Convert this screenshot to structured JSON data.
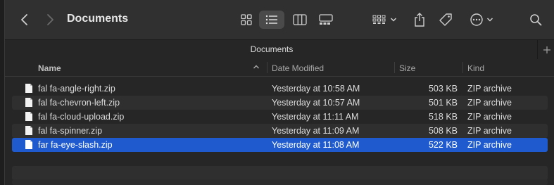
{
  "window": {
    "title": "Documents",
    "tab_label": "Documents"
  },
  "toolbar": {
    "back_icon": "chevron-left-icon",
    "forward_icon": "chevron-right-icon",
    "views": [
      "icon-view",
      "list-view",
      "column-view",
      "gallery-view"
    ],
    "active_view": "list-view"
  },
  "columns": {
    "name": "Name",
    "date": "Date Modified",
    "size": "Size",
    "kind": "Kind"
  },
  "files": [
    {
      "name": "fal fa-angle-right.zip",
      "date": "Yesterday at 10:58 AM",
      "size": "503 KB",
      "kind": "ZIP archive",
      "selected": false
    },
    {
      "name": "fal fa-chevron-left.zip",
      "date": "Yesterday at 10:57 AM",
      "size": "501 KB",
      "kind": "ZIP archive",
      "selected": false
    },
    {
      "name": "fal fa-cloud-upload.zip",
      "date": "Yesterday at 11:11 AM",
      "size": "518 KB",
      "kind": "ZIP archive",
      "selected": false
    },
    {
      "name": "fal fa-spinner.zip",
      "date": "Yesterday at 11:09 AM",
      "size": "508 KB",
      "kind": "ZIP archive",
      "selected": false
    },
    {
      "name": "far fa-eye-slash.zip",
      "date": "Yesterday at 11:08 AM",
      "size": "522 KB",
      "kind": "ZIP archive",
      "selected": true
    }
  ],
  "colors": {
    "selection": "#1f5bce",
    "toolbar_bg": "#303030",
    "window_bg": "#262626"
  }
}
